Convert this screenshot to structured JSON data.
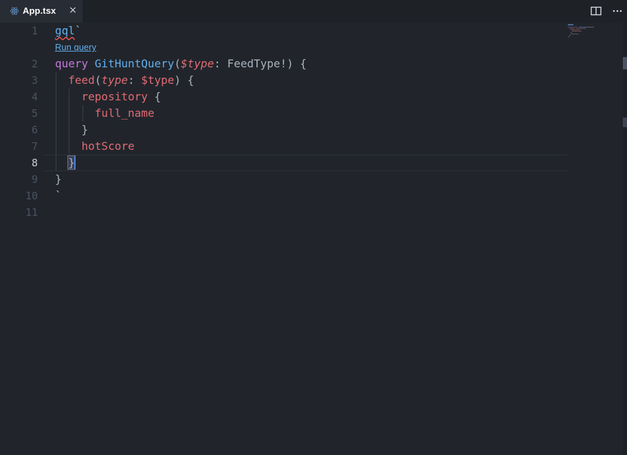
{
  "tab": {
    "filename": "App.tsx",
    "close_glyph": "×",
    "icon": "react-icon"
  },
  "actions": {
    "split_icon": "split-editor-icon",
    "more_icon": "more-actions-icon",
    "more_glyph": "···"
  },
  "editor": {
    "codelens": "Run query",
    "active_line": 8,
    "line_numbers": [
      "1",
      "2",
      "3",
      "4",
      "5",
      "6",
      "7",
      "8",
      "9",
      "10",
      "11"
    ],
    "lines": [
      {
        "n": 1,
        "tokens": [
          {
            "t": "gql",
            "c": "gql"
          },
          {
            "t": "`",
            "c": "punct"
          }
        ]
      },
      {
        "n": 2,
        "tokens": [
          {
            "t": "query ",
            "c": "kw"
          },
          {
            "t": "GitHuntQuery",
            "c": "fn"
          },
          {
            "t": "(",
            "c": "punct"
          },
          {
            "t": "$type",
            "c": "var"
          },
          {
            "t": ": FeedType!) {",
            "c": "type"
          }
        ]
      },
      {
        "n": 3,
        "tokens": [
          {
            "t": "  ",
            "c": "punct"
          },
          {
            "t": "feed",
            "c": "field"
          },
          {
            "t": "(",
            "c": "punct"
          },
          {
            "t": "type",
            "c": "var"
          },
          {
            "t": ": ",
            "c": "punct"
          },
          {
            "t": "$type",
            "c": "vr"
          },
          {
            "t": ") ",
            "c": "punct"
          },
          {
            "t": "{",
            "c": "punct"
          }
        ]
      },
      {
        "n": 4,
        "tokens": [
          {
            "t": "    ",
            "c": "punct"
          },
          {
            "t": "repository",
            "c": "field"
          },
          {
            "t": " {",
            "c": "punct"
          }
        ]
      },
      {
        "n": 5,
        "tokens": [
          {
            "t": "      ",
            "c": "punct"
          },
          {
            "t": "full_name",
            "c": "field"
          }
        ]
      },
      {
        "n": 6,
        "tokens": [
          {
            "t": "    }",
            "c": "punct"
          }
        ]
      },
      {
        "n": 7,
        "tokens": [
          {
            "t": "    ",
            "c": "punct"
          },
          {
            "t": "hotScore",
            "c": "field"
          }
        ]
      },
      {
        "n": 8,
        "tokens": [
          {
            "t": "  ",
            "c": "punct"
          },
          {
            "t": "}",
            "c": "punct bracket-match"
          }
        ]
      },
      {
        "n": 9,
        "tokens": [
          {
            "t": "}",
            "c": "punct"
          }
        ]
      },
      {
        "n": 10,
        "tokens": [
          {
            "t": "`",
            "c": "punct"
          }
        ]
      },
      {
        "n": 11,
        "tokens": []
      }
    ]
  },
  "colors": {
    "background": "#21252b",
    "keyword": "#c678dd",
    "function": "#61afef",
    "variable": "#e06c75",
    "text": "#abb2bf",
    "cursor": "#528bff"
  }
}
